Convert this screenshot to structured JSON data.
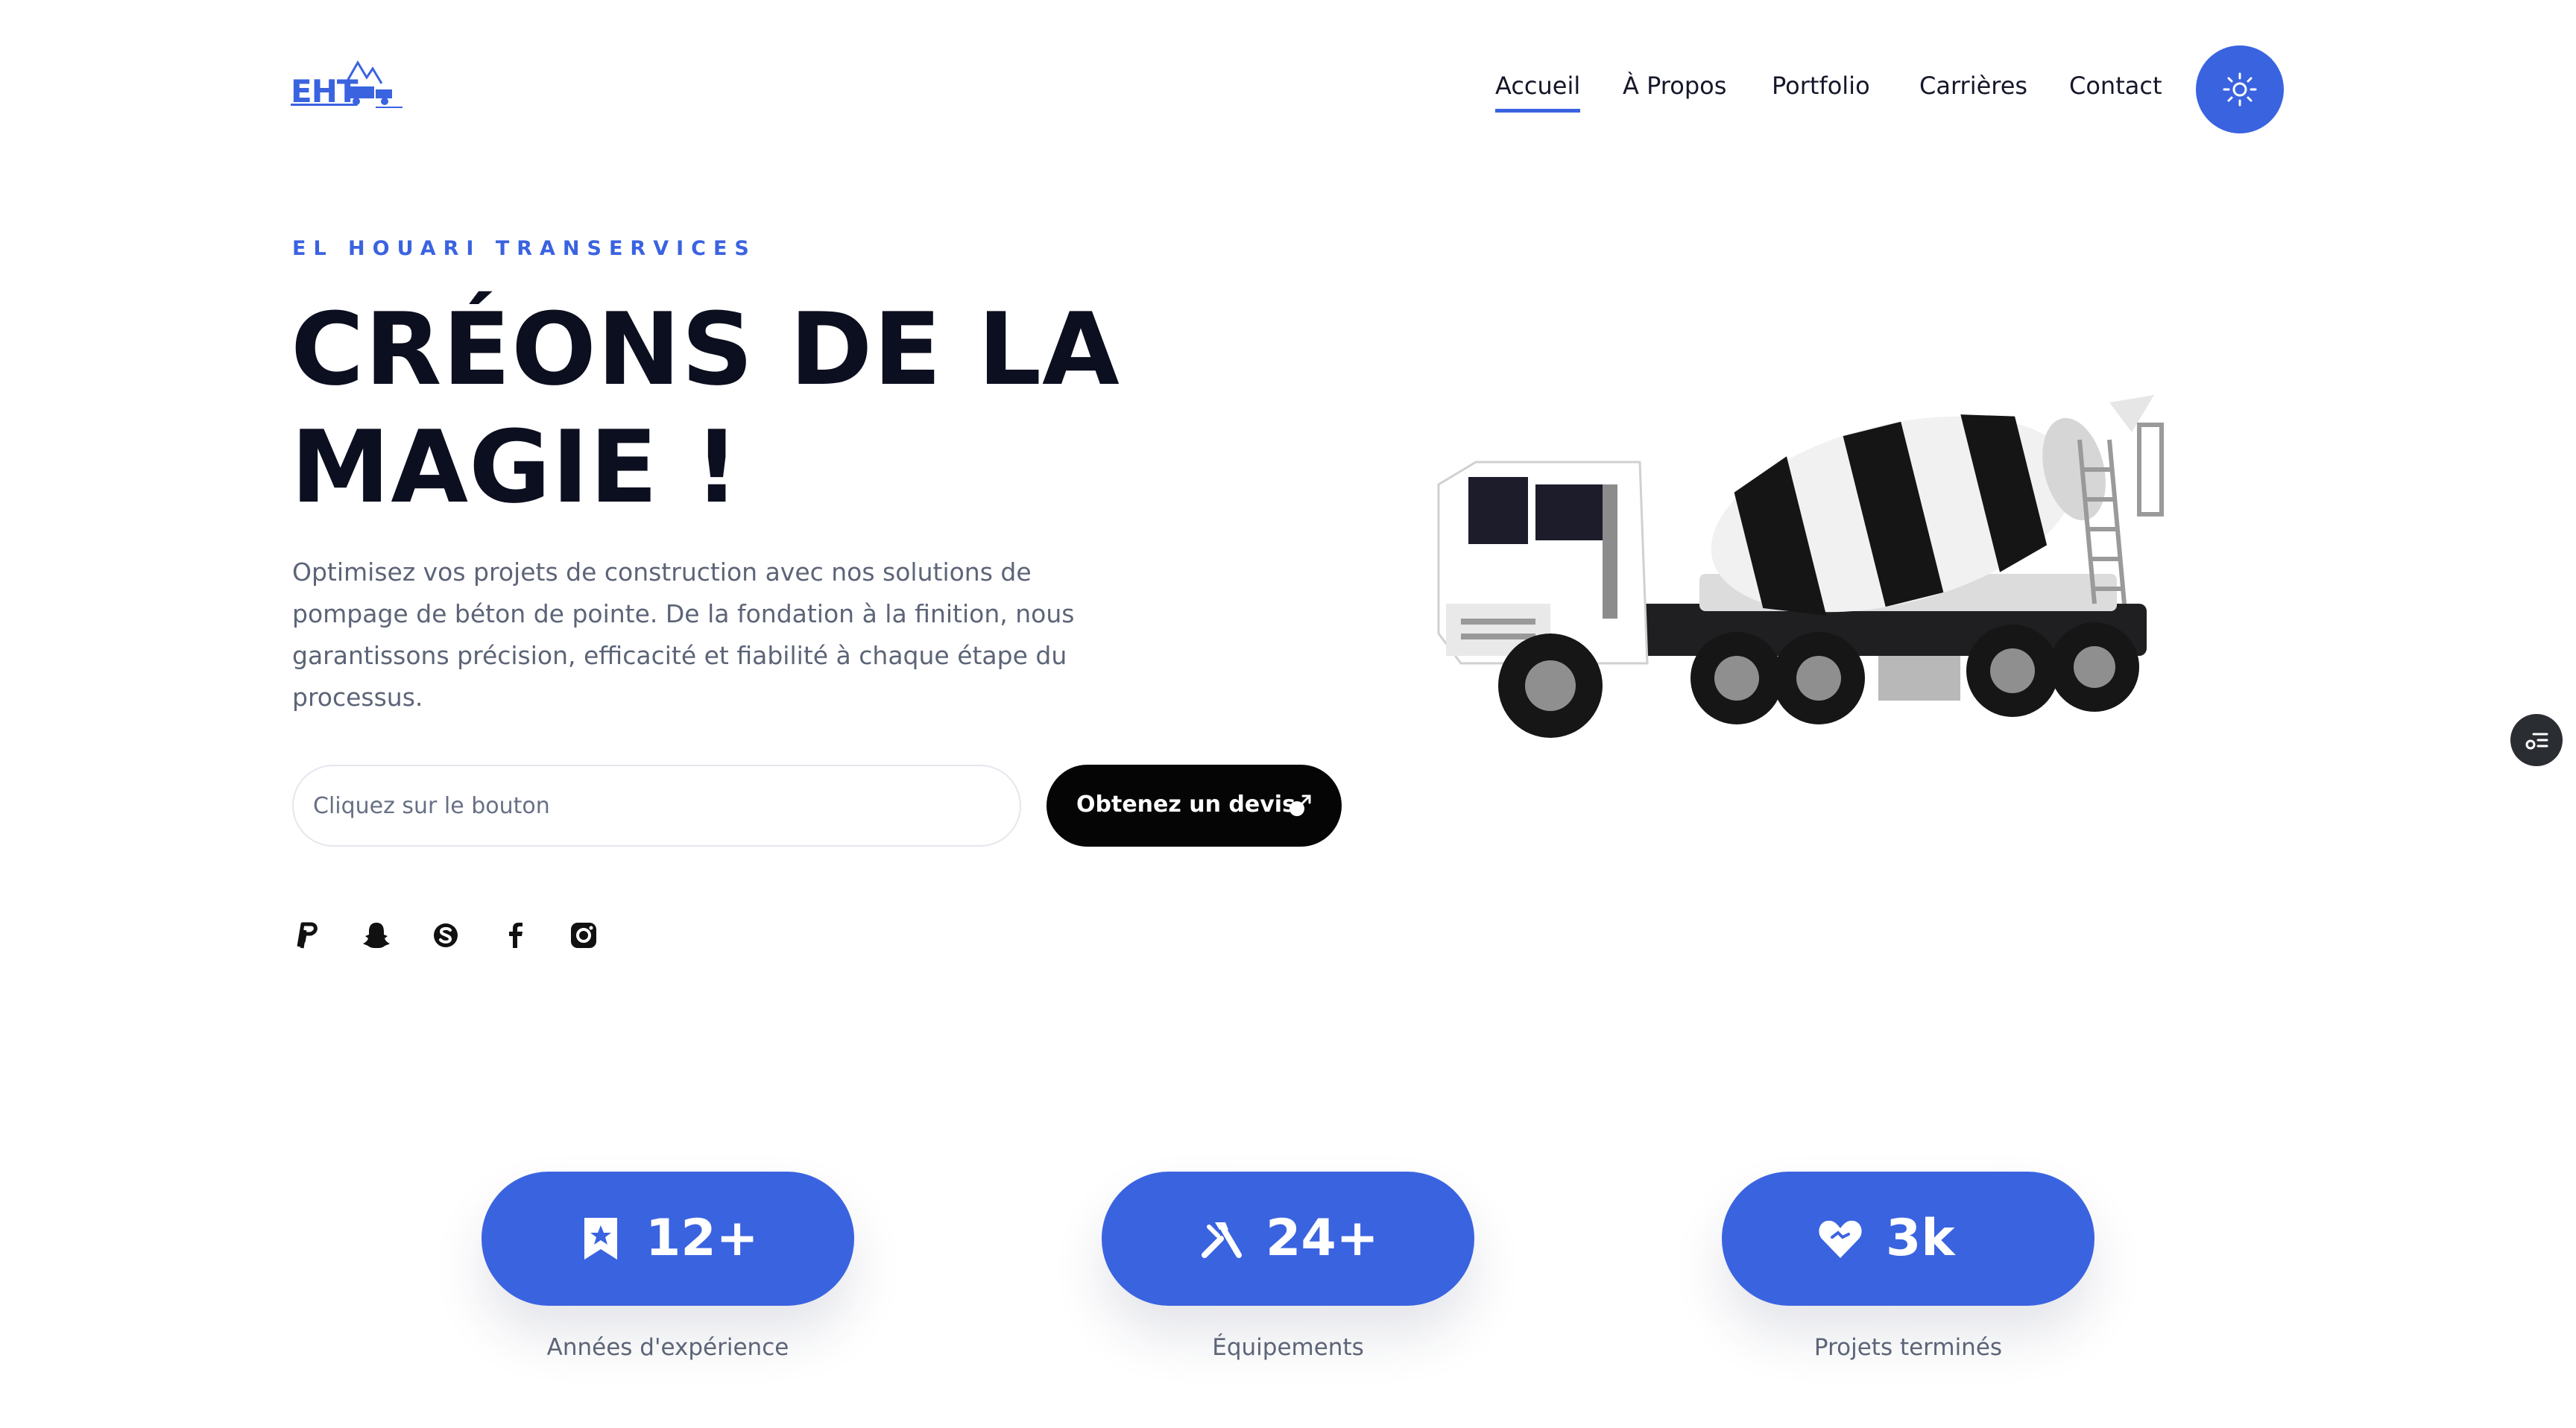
{
  "brand": {
    "logo_text": "EHT"
  },
  "nav": {
    "items": [
      "Accueil",
      "À Propos",
      "Portfolio",
      "Carrières",
      "Contact"
    ],
    "active": "Accueil"
  },
  "hero": {
    "tagline": "EL HOUARI TRANSERVICES",
    "headline": "CRÉONS DE LA MAGIE !",
    "description": "Optimisez vos projets de construction avec nos solutions de pompage de béton de pointe. De la fondation à la finition, nous garantissons précision, efficacité et fiabilité à chaque étape du processus.",
    "input_placeholder": "Cliquez sur le bouton",
    "cta_label": "Obtenez un devis"
  },
  "social": [
    "paypal-icon",
    "snapchat-icon",
    "skype-icon",
    "facebook-icon",
    "instagram-icon"
  ],
  "stats": [
    {
      "icon": "bookmark-star-icon",
      "value": "12+",
      "label": "Années d'expérience"
    },
    {
      "icon": "tools-icon",
      "value": "24+",
      "label": "Équipements"
    },
    {
      "icon": "heart-handshake-icon",
      "value": "3k",
      "label": "Projets terminés"
    }
  ],
  "colors": {
    "accent": "#3a63e0",
    "text_dark": "#0c0f1f",
    "text_muted": "#5c6477",
    "cta_bg": "#050505"
  }
}
